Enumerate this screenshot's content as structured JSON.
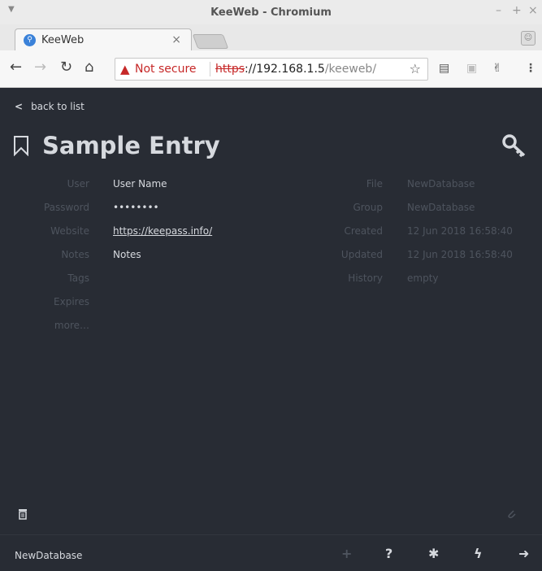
{
  "window": {
    "title": "KeeWeb - Chromium",
    "controls": [
      "–",
      "+",
      "×"
    ]
  },
  "tab": {
    "label": "KeeWeb",
    "close": "×"
  },
  "address_bar": {
    "security_label": "Not secure",
    "url_scheme": "https",
    "url_host": "://192.168.1.5",
    "url_path": "/keeweb/"
  },
  "entry": {
    "back_label": "back to list",
    "title": "Sample Entry",
    "fields_left": [
      {
        "label": "User",
        "value": "User Name"
      },
      {
        "label": "Password",
        "value": "••••••••"
      },
      {
        "label": "Website",
        "value": "https://keepass.info/"
      },
      {
        "label": "Notes",
        "value": "Notes"
      },
      {
        "label": "Tags",
        "value": ""
      },
      {
        "label": "Expires",
        "value": ""
      },
      {
        "label": "more…",
        "value": ""
      }
    ],
    "fields_right": [
      {
        "label": "File",
        "value": "NewDatabase"
      },
      {
        "label": "Group",
        "value": "NewDatabase"
      },
      {
        "label": "Created",
        "value": "12 Jun 2018 16:58:40"
      },
      {
        "label": "Updated",
        "value": "12 Jun 2018 16:58:40"
      },
      {
        "label": "History",
        "value": "empty"
      }
    ]
  },
  "footer": {
    "database_name": "NewDatabase",
    "plus_icon": "+",
    "help_icon": "?",
    "settings_icon": "✱",
    "lock_icon": "ϟ",
    "logout_icon": "➜"
  },
  "colors": {
    "app_background": "#282c34",
    "text_primary": "#d6d9de",
    "text_muted": "#4e545e",
    "not_secure_red": "#c62828"
  }
}
